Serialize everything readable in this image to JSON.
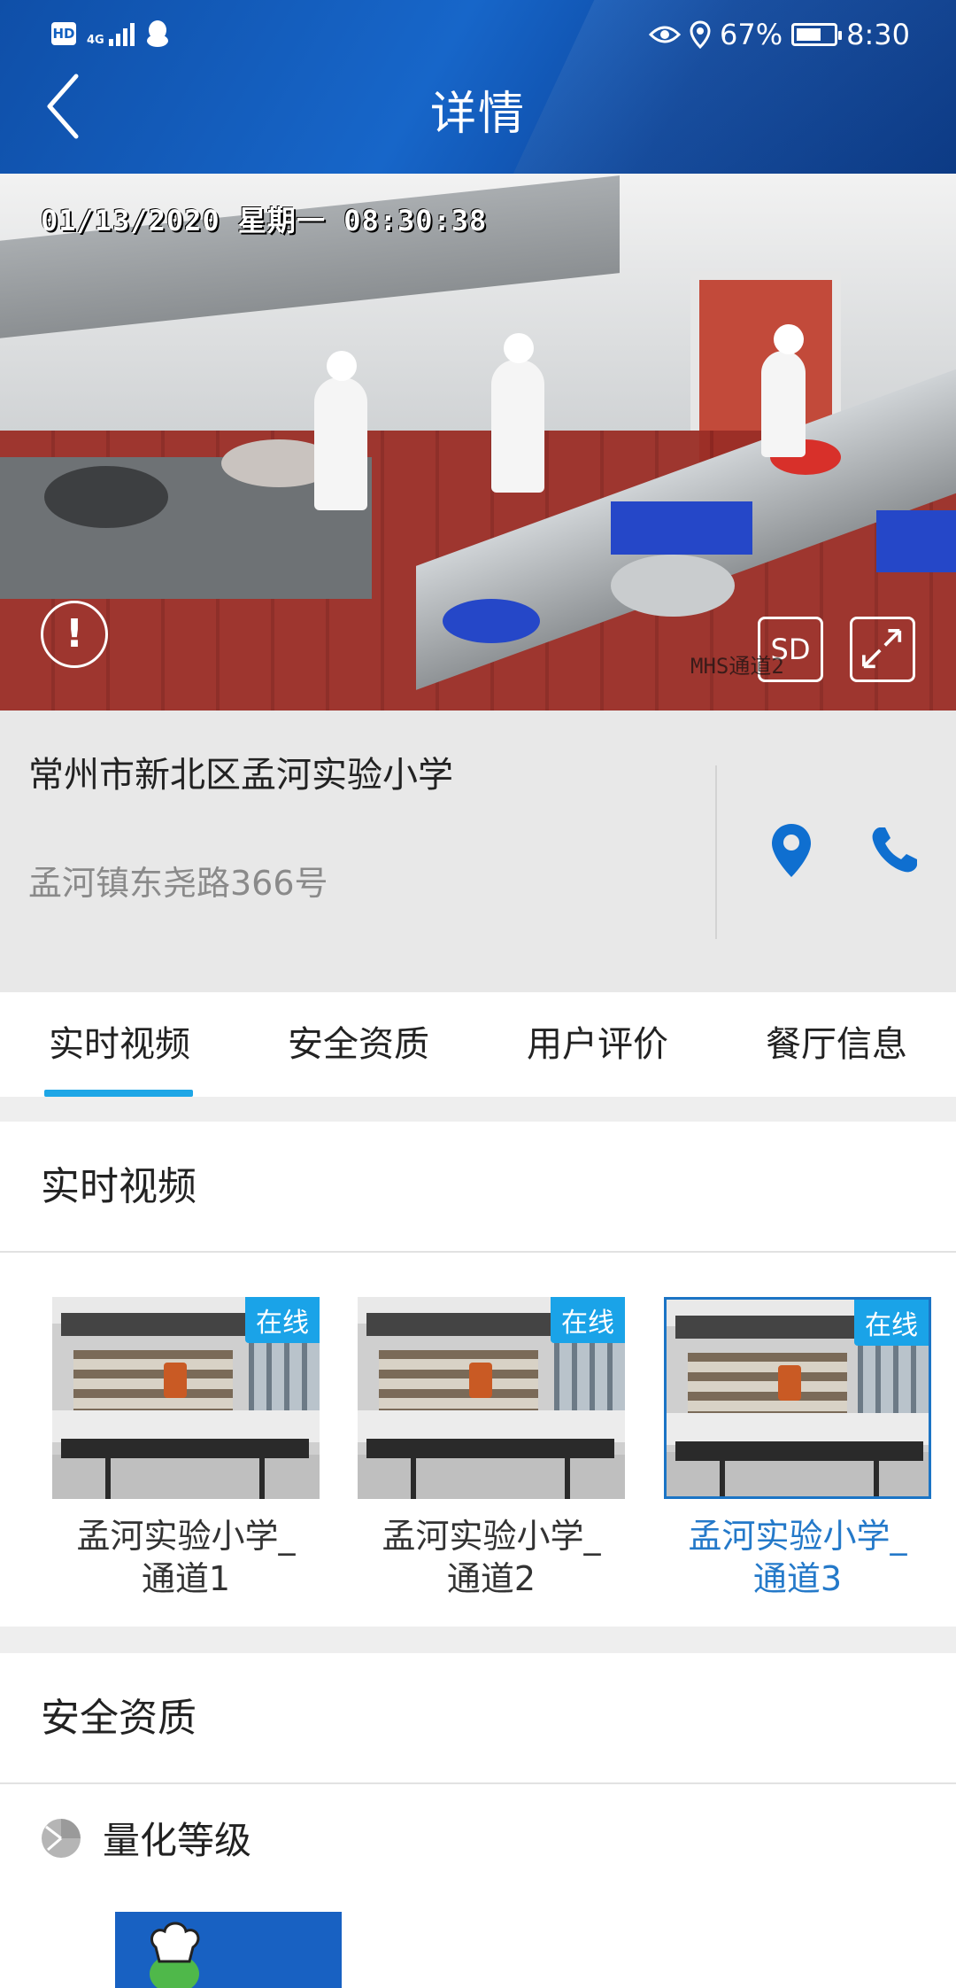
{
  "status_bar": {
    "hd": "HD",
    "network": "4G",
    "battery": "67%",
    "battery_level": 0.67,
    "time": "8:30"
  },
  "header": {
    "title": "详情"
  },
  "video": {
    "osd_timestamp": "01/13/2020  星期一  08:30:38",
    "quality": "SD",
    "camera_label": "MHS通道2"
  },
  "restaurant": {
    "name": "常州市新北区孟河实验小学",
    "address": "孟河镇东尧路366号"
  },
  "tabs": [
    {
      "label": "实时视频",
      "active": true
    },
    {
      "label": "安全资质",
      "active": false
    },
    {
      "label": "用户评价",
      "active": false
    },
    {
      "label": "餐厅信息",
      "active": false
    }
  ],
  "live_video": {
    "title": "实时视频",
    "channels": [
      {
        "status": "在线",
        "name_line1": "孟河实验小学_",
        "name_line2": "通道1",
        "selected": false
      },
      {
        "status": "在线",
        "name_line1": "孟河实验小学_",
        "name_line2": "通道2",
        "selected": false
      },
      {
        "status": "在线",
        "name_line1": "孟河实验小学_",
        "name_line2": "通道3",
        "selected": true
      }
    ]
  },
  "safety": {
    "title": "安全资质",
    "quant_label": "量化等级"
  },
  "colors": {
    "accent": "#1ea6e6",
    "header": "#1160c0",
    "active_text": "#2479c9",
    "icon_blue": "#0f6fd0"
  }
}
